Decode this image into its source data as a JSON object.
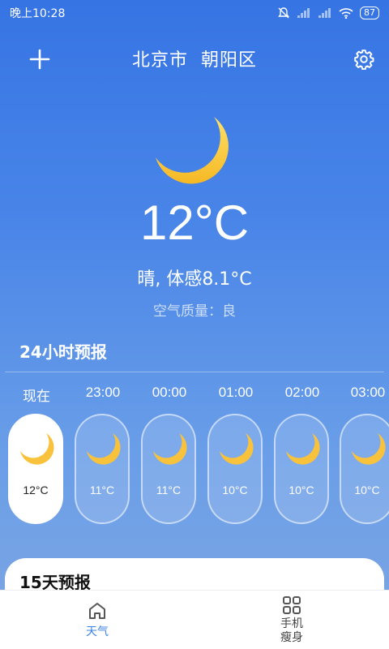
{
  "status": {
    "time": "晚上10:28",
    "battery": "87"
  },
  "header": {
    "city": "北京市  朝阳区"
  },
  "current": {
    "temp": "12°C",
    "condition": "晴, 体感8.1°C",
    "aqi": "空气质量：良"
  },
  "hourly": {
    "title": "24小时预报",
    "items": [
      {
        "time": "现在",
        "temp": "12°C"
      },
      {
        "time": "23:00",
        "temp": "11°C"
      },
      {
        "time": "00:00",
        "temp": "11°C"
      },
      {
        "time": "01:00",
        "temp": "10°C"
      },
      {
        "time": "02:00",
        "temp": "10°C"
      },
      {
        "time": "03:00",
        "temp": "10°C"
      }
    ]
  },
  "daily": {
    "title": "15天预报"
  },
  "nav": {
    "weather": "天气",
    "fitness_line1": "手机",
    "fitness_line2": "瘦身"
  },
  "colors": {
    "accent": "#3b82e6",
    "moon": "#f9c23c",
    "bg_top": "#3674e4"
  }
}
